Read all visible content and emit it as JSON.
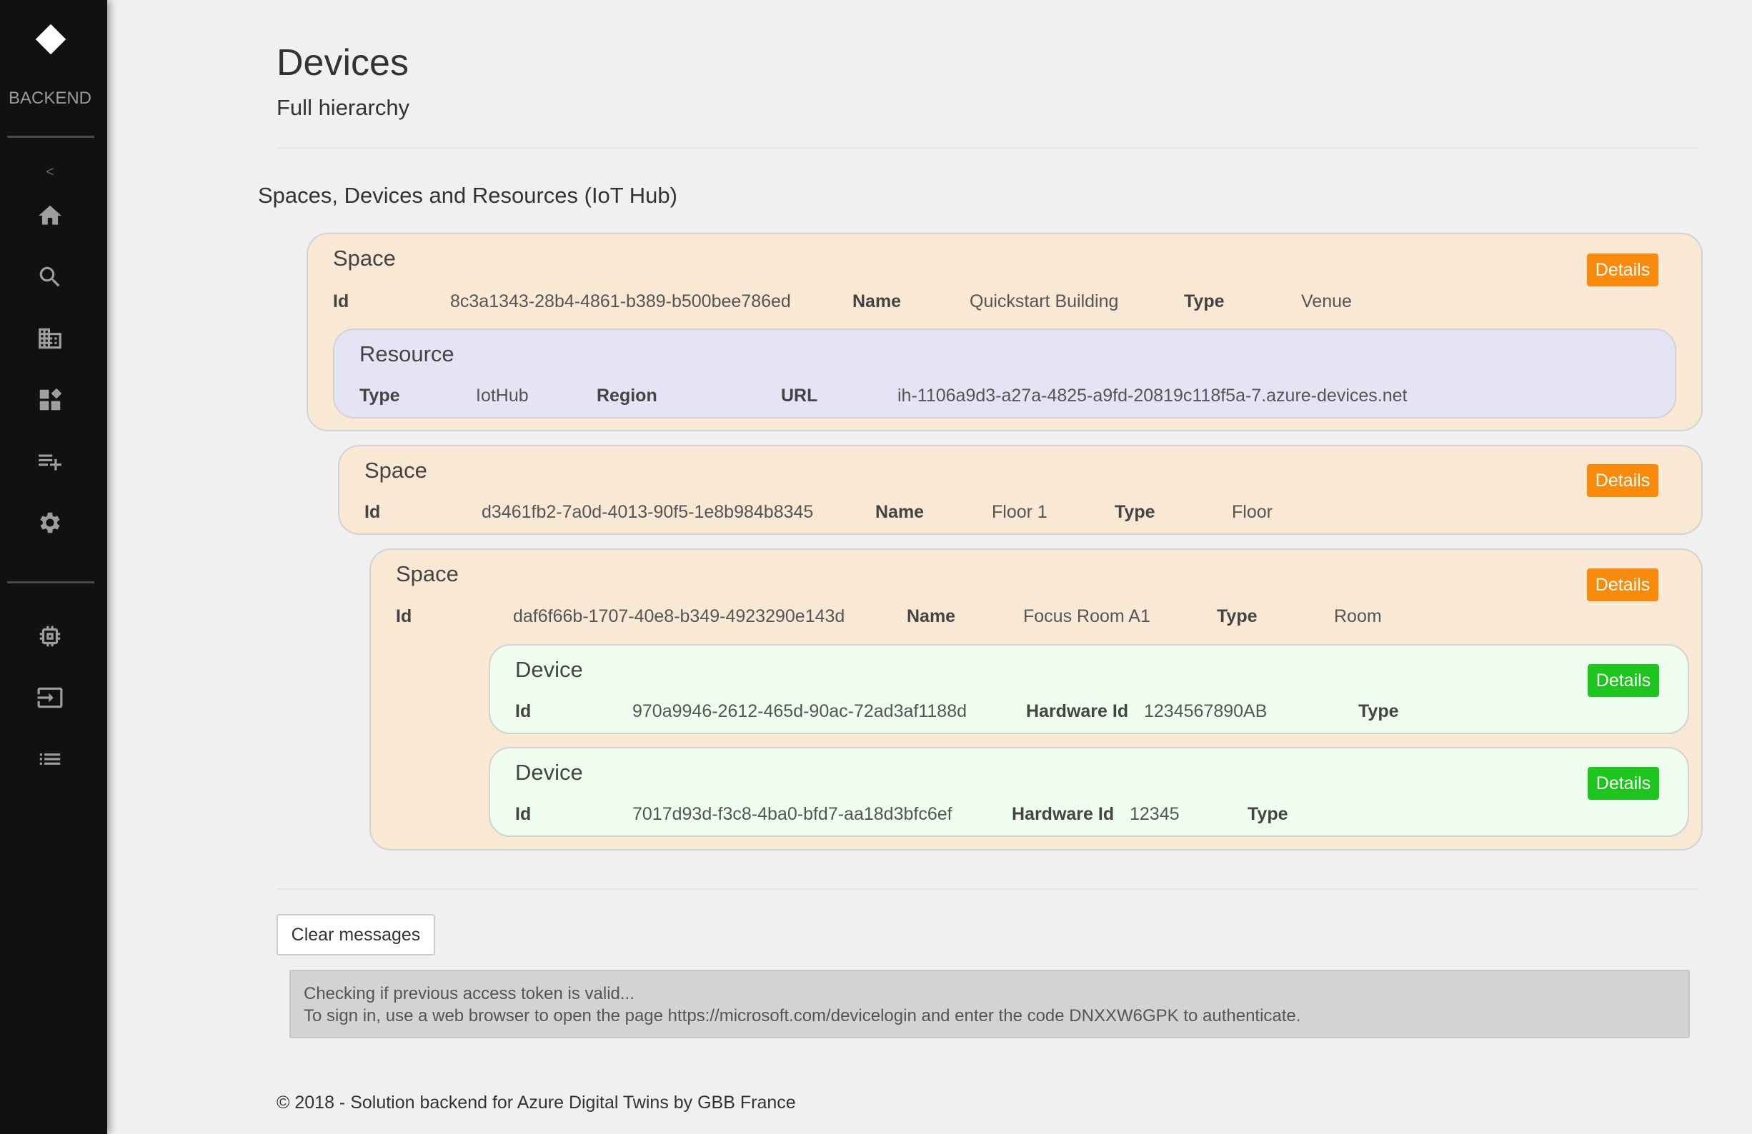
{
  "sidebar": {
    "brand": "BACKEND",
    "collapse": "<",
    "items": [
      {
        "icon": "home-icon"
      },
      {
        "icon": "search-icon"
      },
      {
        "icon": "building-icon"
      },
      {
        "icon": "dashboard-add-icon"
      },
      {
        "icon": "playlist-add-icon"
      },
      {
        "icon": "gear-icon"
      },
      {
        "icon": "chip-icon"
      },
      {
        "icon": "login-icon"
      },
      {
        "icon": "list-icon"
      }
    ]
  },
  "page": {
    "title": "Devices",
    "subtitle": "Full hierarchy",
    "section_title": "Spaces, Devices and Resources (IoT Hub)"
  },
  "labels": {
    "id": "Id",
    "name": "Name",
    "type": "Type",
    "region": "Region",
    "url": "URL",
    "hardware_id": "Hardware Id",
    "details": "Details"
  },
  "hierarchy": {
    "space1": {
      "title": "Space",
      "id": "8c3a1343-28b4-4861-b389-b500bee786ed",
      "name": "Quickstart Building",
      "type": "Venue"
    },
    "resource1": {
      "title": "Resource",
      "type": "IotHub",
      "region": "",
      "url": "ih-1106a9d3-a27a-4825-a9fd-20819c118f5a-7.azure-devices.net"
    },
    "space2": {
      "title": "Space",
      "id": "d3461fb2-7a0d-4013-90f5-1e8b984b8345",
      "name": "Floor 1",
      "type": "Floor"
    },
    "space3": {
      "title": "Space",
      "id": "daf6f66b-1707-40e8-b349-4923290e143d",
      "name": "Focus Room A1",
      "type": "Room"
    },
    "device1": {
      "title": "Device",
      "id": "970a9946-2612-465d-90ac-72ad3af1188d",
      "hardware_id": "1234567890AB",
      "type": ""
    },
    "device2": {
      "title": "Device",
      "id": "7017d93d-f3c8-4ba0-bfd7-aa18d3bfc6ef",
      "hardware_id": "12345",
      "type": ""
    }
  },
  "messages": {
    "clear_label": "Clear messages",
    "lines": [
      "Checking if previous access token is valid...",
      "To sign in, use a web browser to open the page https://microsoft.com/devicelogin and enter the code DNXXW6GPK to authenticate."
    ]
  },
  "footer": "© 2018 - Solution backend for Azure Digital Twins by GBB France",
  "colors": {
    "sidebar": "#111111",
    "space_bg": "#f9e8d4",
    "resource_bg": "#e4e4f5",
    "device_bg": "#effdee",
    "details_space": "#f98a0b",
    "details_device": "#1ec51e"
  }
}
